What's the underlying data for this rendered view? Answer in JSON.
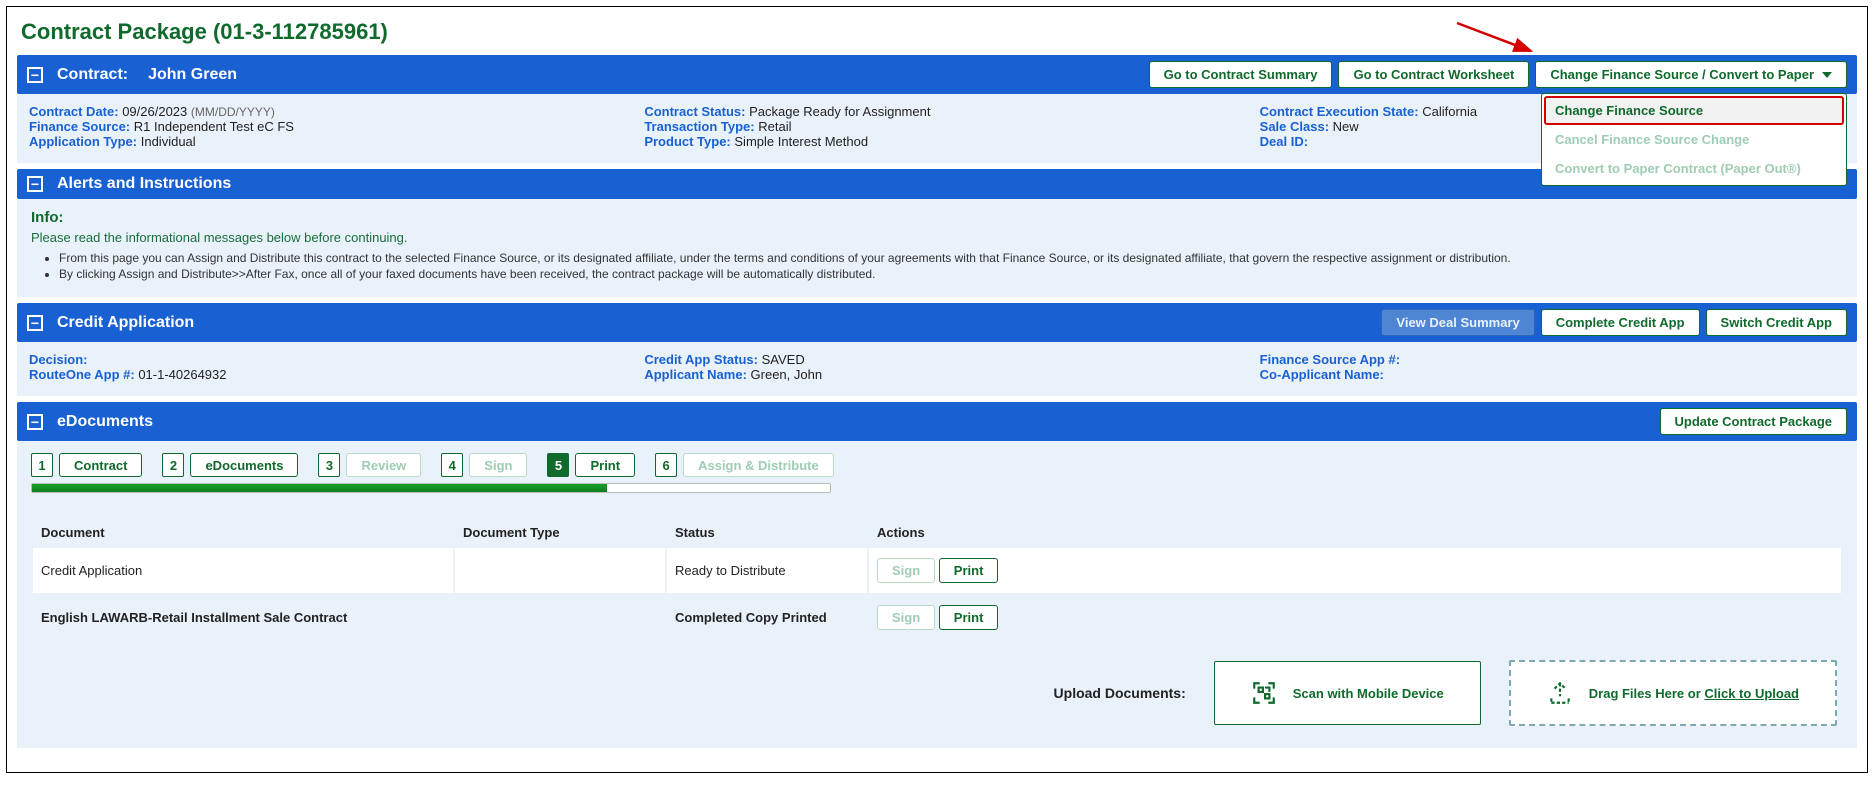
{
  "pageTitle": "Contract Package (01-3-112785961)",
  "contractHeader": {
    "titlePrefix": "Contract:",
    "name": "John Green",
    "btnSummary": "Go to Contract Summary",
    "btnWorksheet": "Go to Contract Worksheet",
    "btnDropdown": "Change Finance Source / Convert to Paper",
    "dropdown": {
      "change": "Change Finance Source",
      "cancel": "Cancel Finance Source Change",
      "convert": "Convert to Paper Contract (Paper Out®)"
    }
  },
  "contractDetails": {
    "col1": {
      "contractDateLabel": "Contract Date:",
      "contractDate": "09/26/2023",
      "contractDateHint": "(MM/DD/YYYY)",
      "financeSourceLabel": "Finance Source:",
      "financeSource": "R1 Independent Test eC FS",
      "appTypeLabel": "Application Type:",
      "appType": "Individual"
    },
    "col2": {
      "contractStatusLabel": "Contract Status:",
      "contractStatus": "Package Ready for Assignment",
      "transTypeLabel": "Transaction Type:",
      "transType": "Retail",
      "productTypeLabel": "Product Type:",
      "productType": "Simple Interest Method"
    },
    "col3": {
      "execStateLabel": "Contract Execution State:",
      "execState": "California",
      "saleClassLabel": "Sale Class:",
      "saleClass": "New",
      "dealIdLabel": "Deal ID:",
      "dealId": ""
    }
  },
  "alerts": {
    "header": "Alerts and Instructions",
    "infoTitle": "Info:",
    "infoMsg": "Please read the informational messages below before continuing.",
    "bullet1": "From this page you can Assign and Distribute this contract to the selected Finance Source, or its designated affiliate, under the terms and conditions of your agreements with that Finance Source, or its designated affiliate, that govern the respective assignment or distribution.",
    "bullet2": "By clicking Assign and Distribute>>After Fax, once all of your faxed documents have been received, the contract package will be automatically distributed."
  },
  "creditApp": {
    "header": "Credit Application",
    "btnViewDeal": "View Deal Summary",
    "btnComplete": "Complete Credit App",
    "btnSwitch": "Switch Credit App",
    "decisionLabel": "Decision:",
    "decision": "",
    "routeOneLabel": "RouteOne App #:",
    "routeOne": "01-1-40264932",
    "statusLabel": "Credit App Status:",
    "status": "SAVED",
    "applicantLabel": "Applicant Name:",
    "applicant": "Green, John",
    "fsAppLabel": "Finance Source App #:",
    "fsApp": "",
    "coAppLabel": "Co-Applicant Name:",
    "coApp": ""
  },
  "eDocs": {
    "header": "eDocuments",
    "btnUpdate": "Update Contract Package",
    "steps": {
      "s1": "Contract",
      "s2": "eDocuments",
      "s3": "Review",
      "s4": "Sign",
      "s5": "Print",
      "s6": "Assign & Distribute"
    },
    "columns": {
      "doc": "Document",
      "type": "Document Type",
      "status": "Status",
      "actions": "Actions"
    },
    "rows": [
      {
        "doc": "Credit Application",
        "type": "",
        "status": "Ready to Distribute"
      },
      {
        "doc": "English LAWARB-Retail Installment Sale Contract",
        "type": "",
        "status": "Completed Copy Printed"
      }
    ],
    "actions": {
      "sign": "Sign",
      "print": "Print"
    },
    "uploadLabel": "Upload Documents:",
    "scanLabel": "Scan with Mobile Device",
    "dragLabel": "Drag Files Here or ",
    "clickUpload": "Click to Upload"
  }
}
